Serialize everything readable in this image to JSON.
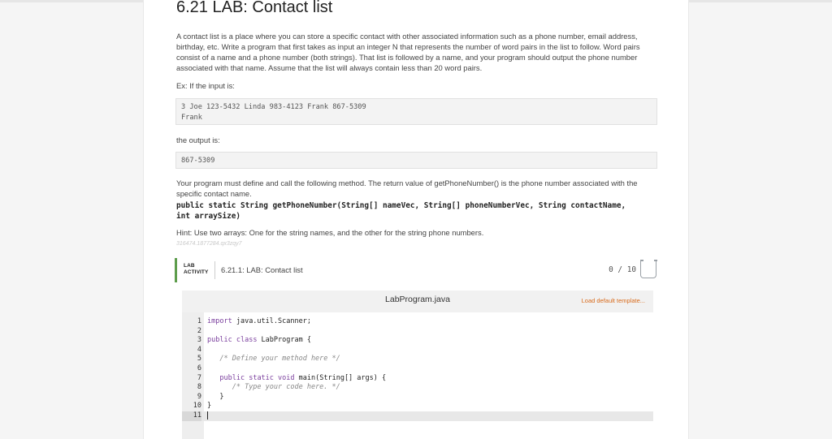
{
  "title": "6.21 LAB: Contact list",
  "intro": "A contact list is a place where you can store a specific contact with other associated information such as a phone number, email address, birthday, etc. Write a program that first takes as input an integer N that represents the number of word pairs in the list to follow. Word pairs consist of a name and a phone number (both strings). That list is followed by a name, and your program should output the phone number associated with that name. Assume that the list will always contain less than 20 word pairs.",
  "example_label": "Ex: If the input is:",
  "example_input": "3 Joe 123-5432 Linda 983-4123 Frank 867-5309\nFrank",
  "output_label": "the output is:",
  "example_output": "867-5309",
  "method_text": "Your program must define and call the following method. The return value of getPhoneNumber() is the phone number associated with the specific contact name.",
  "signature_line1": "public static String getPhoneNumber(String[] nameVec, String[] phoneNumberVec, String contactName,",
  "signature_line2": "int arraySize)",
  "hint": "Hint: Use two arrays: One for the string names, and the other for the string phone numbers.",
  "faint_text": "316474.1877284.qx3zqy7",
  "activity": {
    "label_line1": "LAB",
    "label_line2": "ACTIVITY",
    "title": "6.21.1: LAB: Contact list",
    "score": "0 / 10"
  },
  "editor": {
    "file_name": "LabProgram.java",
    "load_template": "Load default template...",
    "line_numbers": [
      "1",
      "2",
      "3",
      "4",
      "5",
      "6",
      "7",
      "8",
      "9",
      "10",
      "11"
    ]
  },
  "colors": {
    "activity_bar": "#5d9d4c",
    "load_template": "#d86a1b",
    "keyword": "#7a3e9d"
  }
}
